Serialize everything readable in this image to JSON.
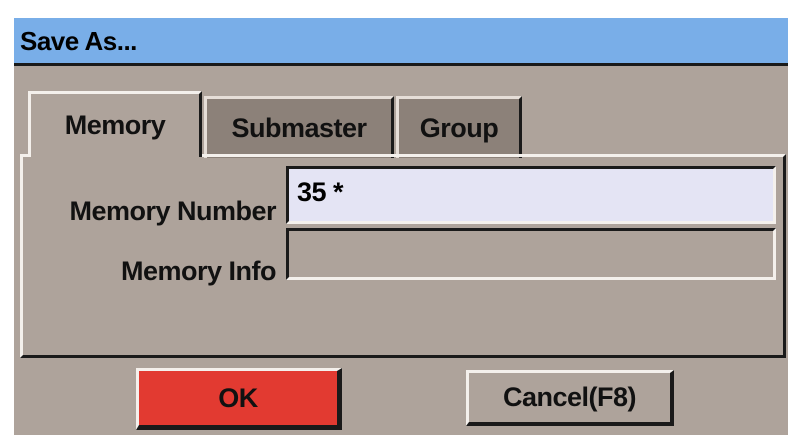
{
  "window": {
    "title": "Save As..."
  },
  "tabs": [
    {
      "label": "Memory",
      "active": true
    },
    {
      "label": "Submaster",
      "active": false
    },
    {
      "label": "Group",
      "active": false
    }
  ],
  "form": {
    "memory_number_label": "Memory Number",
    "memory_number_value": "35 *",
    "memory_info_label": "Memory Info",
    "memory_info_value": ""
  },
  "buttons": {
    "ok_label": "OK",
    "cancel_label": "Cancel(F8)"
  },
  "colors": {
    "titlebar": "#79aee8",
    "dialog_bg": "#aea39b",
    "ok_button": "#e23a31",
    "input_bg": "#e4e4f4"
  }
}
